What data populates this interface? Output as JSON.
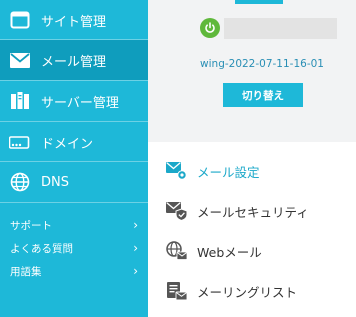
{
  "colors": {
    "sidebar": "#1eb8d8",
    "sidebar_active": "#0f9dbd",
    "accent": "#1ba8c9",
    "power": "#5fb83b"
  },
  "sidebar": {
    "items": [
      {
        "label": "サイト管理",
        "icon": "window-icon"
      },
      {
        "label": "メール管理",
        "icon": "envelope-icon",
        "active": true
      },
      {
        "label": "サーバー管理",
        "icon": "server-icon"
      },
      {
        "label": "ドメイン",
        "icon": "domain-icon"
      },
      {
        "label": "DNS",
        "icon": "globe-icon"
      }
    ],
    "sub_items": [
      {
        "label": "サポート"
      },
      {
        "label": "よくある質問"
      },
      {
        "label": "用語集"
      }
    ]
  },
  "account": {
    "hostname": "wing-2022-07-11-16-01",
    "switch_label": "切り替え",
    "status_icon": "power-icon"
  },
  "menu": {
    "items": [
      {
        "label": "メール設定",
        "icon": "mail-settings-icon",
        "active": true
      },
      {
        "label": "メールセキュリティ",
        "icon": "mail-shield-icon"
      },
      {
        "label": "Webメール",
        "icon": "web-mail-icon"
      },
      {
        "label": "メーリングリスト",
        "icon": "mailing-list-icon"
      }
    ]
  }
}
